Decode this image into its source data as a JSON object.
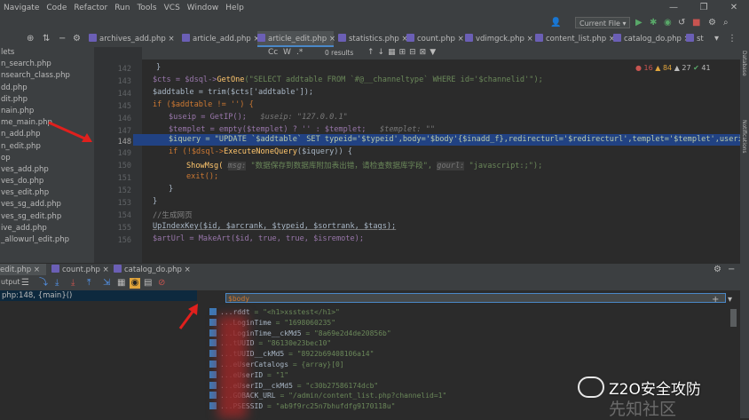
{
  "menu": [
    "Navigate",
    "Code",
    "Refactor",
    "Run",
    "Tools",
    "VCS",
    "Window",
    "Help"
  ],
  "window_controls": [
    "—",
    "❐",
    "✕"
  ],
  "toolbar": {
    "run_config": "Current File ▾"
  },
  "tabs": [
    "archives_add.php",
    "article_add.php",
    "article_edit.php",
    "statistics.php",
    "count.php",
    "vdimgck.php",
    "content_list.php",
    "catalog_do.php",
    "st"
  ],
  "active_tab": "article_edit.php",
  "project_items": [
    "lets",
    "n_search.php",
    "nsearch_class.php",
    "dd.php",
    "dit.php",
    "nain.php",
    "me_main.php",
    "n_add.php",
    "n_edit.php",
    "op",
    "ves_add.php",
    "ves_do.php",
    "ves_edit.php",
    "ves_sg_add.php",
    "ves_sg_edit.php",
    "ive_add.php",
    "_allowurl_edit.php"
  ],
  "find": {
    "results": "0 results",
    "case": "Cc",
    "word": "W"
  },
  "inspections": {
    "errors": "16",
    "warnings": "84",
    "weak": "27",
    "typos": "41"
  },
  "line_numbers": [
    "142",
    "143",
    "144",
    "145",
    "146",
    "147",
    "148",
    "149",
    "150",
    "151",
    "152",
    "153",
    "154",
    "155",
    "156"
  ],
  "code": {
    "l142": "}",
    "l143a": "$cts = $dsql->",
    "l143fn": "GetOne",
    "l143b": "(\"SELECT addtable FROM `#@__channeltype` WHERE id='$channelid'\");",
    "l144": "$addtable = trim($cts['addtable']);",
    "l145": "if ($addtable != '') {",
    "l146": "$useip = GetIP();",
    "l146hint": "$useip: \"127.0.0.1\"",
    "l147": "$templet = empty($templet) ? '' : $templet;",
    "l147hint": "$templet: \"\"",
    "l148": "$iquery = \"UPDATE `$addtable` SET typeid='$typeid',body='$body'{$inadd_f},redirecturl='$redirecturl',templet='$templet',userip='$",
    "l149a": "if (!$dsql->",
    "l149fn": "ExecuteNoneQuery",
    "l149b": "($iquery)) {",
    "l150a": "ShowMsg(",
    "l150hint1": "msg:",
    "l150b": "\"数据保存到数据库附加表出错，请检查数据库字段\",",
    "l150hint2": "gourl:",
    "l150c": "\"javascript:;\");",
    "l151": "exit();",
    "l152": "}",
    "l153": "}",
    "l154": "//生成网页",
    "l155": "UpIndexKey($id, $arcrank, $typeid, $sortrank, $tags);",
    "l156": "$artUrl = MakeArt($id, true, true, $isremote);"
  },
  "debug_tabs": [
    "edit.php",
    "count.php",
    "catalog_do.php"
  ],
  "debug_label": "utput",
  "frame": "php:148, {main}()",
  "watch_expression": "$body",
  "variables": [
    {
      "name": "...rddt",
      "value": "= \"<h1>xsstest</h1>\""
    },
    {
      "name": "...LoginTime",
      "value": "= \"1698060235\""
    },
    {
      "name": "...LoginTime__ckMd5",
      "value": "= \"8a69e2d4de20856b\""
    },
    {
      "name": "...tUUID",
      "value": "= \"86130e23bec10\""
    },
    {
      "name": "...tUUID__ckMd5",
      "value": "= \"8922b69408106a14\""
    },
    {
      "name": "...eUserCatalogs",
      "value": "= {array}[0]"
    },
    {
      "name": "...eUserID",
      "value": "= \"1\""
    },
    {
      "name": "...eUserID__ckMd5",
      "value": "= \"c30b27586174dcb\""
    },
    {
      "name": "...GOBACK_URL",
      "value": "= \"/admin/content_list.php?channelid=1\""
    },
    {
      "name": "...PSESSID",
      "value": "= \"ab9f9rc25n7bhufdfg9170118u\""
    }
  ],
  "watermark": {
    "title": "Z2O安全攻防",
    "sub": "先知社区"
  },
  "colors": {
    "accent": "#4a88c7",
    "selection": "#214283",
    "arrow": "#e0201d"
  }
}
